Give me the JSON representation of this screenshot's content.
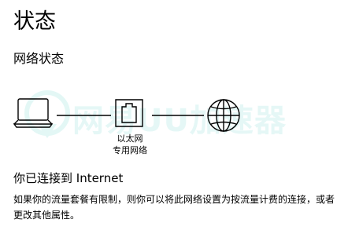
{
  "page": {
    "title": "状态"
  },
  "network": {
    "section_title": "网络状态",
    "adapter_name": "以太网",
    "adapter_type": "专用网络",
    "status_heading": "你已连接到 Internet",
    "status_description": "如果你的流量套餐有限制，则你可以将此网络设置为按流量计费的连接，或者更改其他属性。"
  },
  "watermark": {
    "text": "网易UU加速器",
    "color": "#21c1b6"
  },
  "icons": {
    "computer": "laptop-icon",
    "adapter": "ethernet-port-icon",
    "internet": "globe-icon"
  },
  "colors": {
    "text": "#000000",
    "icon_stroke": "#000000",
    "background": "#ffffff"
  }
}
